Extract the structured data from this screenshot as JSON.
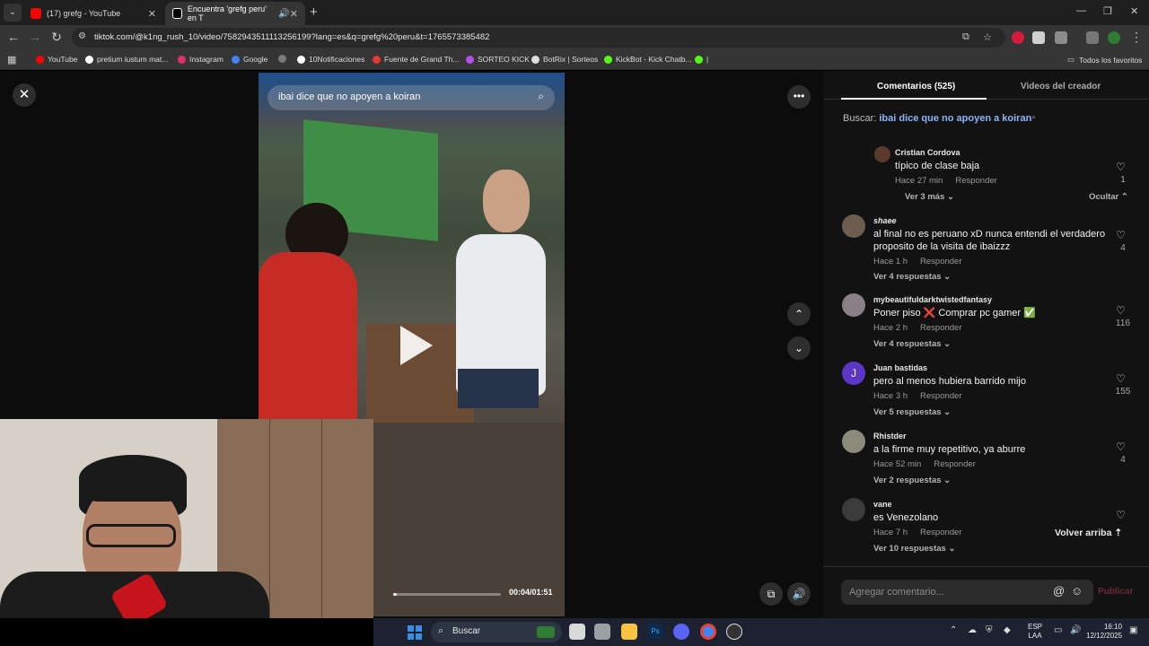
{
  "browser": {
    "tabs": [
      {
        "label": "(17) grefg - YouTube",
        "color": "#ff0000"
      },
      {
        "label": "Encuentra 'grefg peru' en T",
        "color": "#ffffff"
      }
    ],
    "url": "tiktok.com/@k1ng_rush_10/video/7582943511113256199?lang=es&q=grefg%20peru&t=1765573385482",
    "bookmarks": [
      {
        "label": "YouTube",
        "color": "#ff0000"
      },
      {
        "label": "pretium iustum mat...",
        "color": "#ffffff"
      },
      {
        "label": "Instagram",
        "color": "#e1306c"
      },
      {
        "label": "Google",
        "color": "#4285f4"
      },
      {
        "label": "",
        "color": "#7a7a7a"
      },
      {
        "label": "10Notificaciones",
        "color": "#ffffff"
      },
      {
        "label": "Fuente de Grand Th...",
        "color": "#e53935"
      },
      {
        "label": "SORTEO KICK",
        "color": "#b44ee6"
      },
      {
        "label": "BotRix | Sorteos",
        "color": "#dddddd"
      },
      {
        "label": "KickBot - Kick Chatb...",
        "color": "#53fc18"
      },
      {
        "label": "|",
        "color": "#53fc18"
      }
    ],
    "all_bookmarks": "Todos los favoritos"
  },
  "video": {
    "search_query": "ibai dice que no apoyen a koiran",
    "time": "00:04/01:51",
    "progress": 0.036
  },
  "panel": {
    "tab_comments": "Comentarios (525)",
    "tab_creator": "Videos del creador",
    "search_label": "Buscar:",
    "search_value": "ibai dice que no apoyen a koiran",
    "reply_label": "Responder",
    "hide_label": "Ocultar",
    "back_to_top": "Volver arriba",
    "input_placeholder": "Agregar comentario...",
    "publish": "Publicar",
    "comments": [
      {
        "user": "Cristian Cordova",
        "text": "típico de clase baja",
        "time": "Hace 27 min",
        "likes": "1",
        "more": "Ver 3 más",
        "avatar": "#5a3b2e"
      },
      {
        "user": "shaee",
        "text": "al final no es peruano xD nunca entendi el verdadero proposito de la visita de ibaizzz",
        "time": "Hace 1 h",
        "likes": "4",
        "more": "Ver 4 respuestas",
        "avatar": "#6d5d4e"
      },
      {
        "user": "mybeautifuldarktwistedfantasy",
        "text": "Poner piso ❌ Comprar pc gamer ✅",
        "time": "Hace 2 h",
        "likes": "116",
        "more": "Ver 4 respuestas",
        "avatar": "#8a7f86"
      },
      {
        "user": "Juan bastidas",
        "text": "pero al menos hubiera barrido mijo",
        "time": "Hace 3 h",
        "likes": "155",
        "more": "Ver 5 respuestas",
        "avatar": "#5d35c9",
        "initial": "J"
      },
      {
        "user": "Rhistder",
        "text": "a la firme muy repetitivo, ya aburre",
        "time": "Hace 52 min",
        "likes": "4",
        "more": "Ver 2 respuestas",
        "avatar": "#8c8a7a"
      },
      {
        "user": "vane",
        "text": "es Venezolano",
        "time": "Hace 7 h",
        "likes": "",
        "more": "Ver 10 respuestas",
        "avatar": "#3b3b3b"
      }
    ]
  },
  "taskbar": {
    "search_label": "Buscar",
    "lang_line1": "ESP",
    "lang_line2": "LAA",
    "time": "16:10",
    "date": "12/12/2025"
  }
}
